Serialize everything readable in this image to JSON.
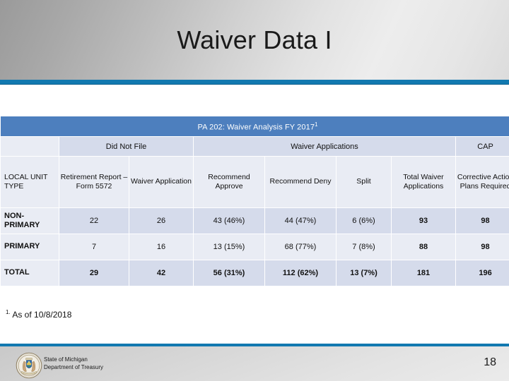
{
  "slide": {
    "title": "Waiver Data I",
    "page_number": "18",
    "accent_color": "#1279b0",
    "band_color": "#4d7fbe",
    "header_cell_color": "#d5dbeb",
    "light_cell_color": "#e9ecf4"
  },
  "table": {
    "banner": "PA 202: Waiver Analysis FY 2017",
    "banner_footnote_marker": "1",
    "group_headers": [
      {
        "label": "",
        "span": 1
      },
      {
        "label": "Did Not File",
        "span": 2
      },
      {
        "label": "Waiver Applications",
        "span": 4
      },
      {
        "label": "CAP",
        "span": 1
      }
    ],
    "columns": [
      "LOCAL UNIT TYPE",
      "Retirement Report – Form 5572",
      "Waiver Application",
      "Recommend Approve",
      "Recommend Deny",
      "Split",
      "Total Waiver Applications",
      "Corrective Action Plans Required"
    ],
    "rows": [
      {
        "label": "NON-PRIMARY",
        "values": [
          "22",
          "26",
          "43 (46%)",
          "44 (47%)",
          "6 (6%)",
          "93",
          "98"
        ]
      },
      {
        "label": "PRIMARY",
        "values": [
          "7",
          "16",
          "13 (15%)",
          "68 (77%)",
          "7 (8%)",
          "88",
          "98"
        ]
      },
      {
        "label": "TOTAL",
        "values": [
          "29",
          "42",
          "56 (31%)",
          "112 (62%)",
          "13 (7%)",
          "181",
          "196"
        ]
      }
    ]
  },
  "footnote": {
    "marker": "1.",
    "text": "As of 10/8/2018"
  },
  "footer": {
    "org_line1": "State of Michigan",
    "org_line2": "Department of Treasury"
  }
}
